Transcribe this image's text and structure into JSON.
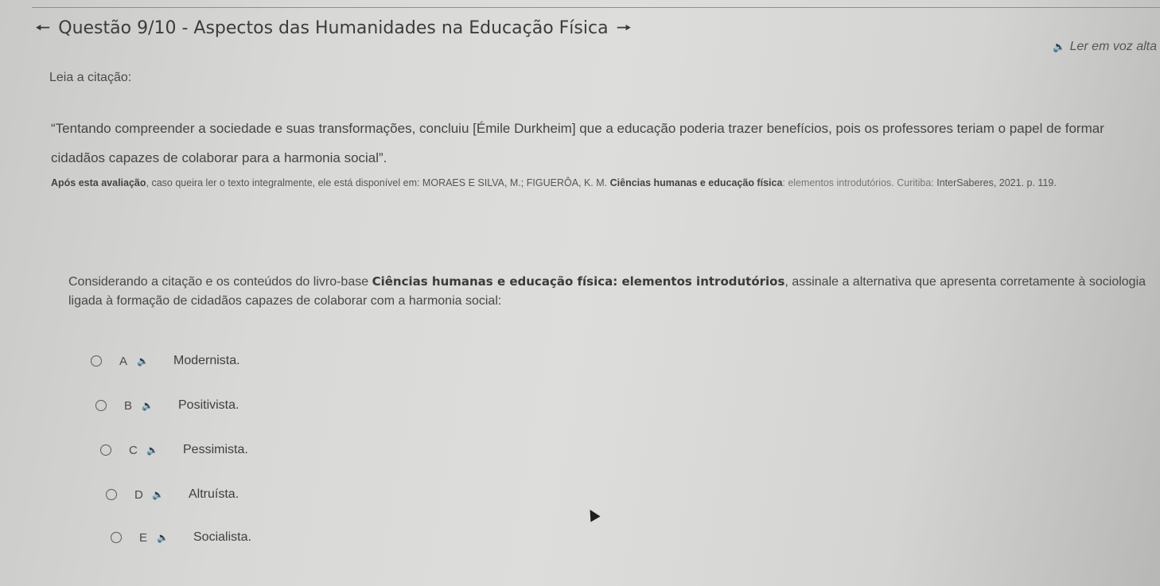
{
  "header": {
    "title": "Questão 9/10 - Aspectos das Humanidades na Educação Física",
    "prev_icon": "arrow-left-icon",
    "next_icon": "arrow-right-icon"
  },
  "read_aloud": {
    "label": "Ler em voz alta",
    "icon": "speaker-icon"
  },
  "instruction": "Leia a citação:",
  "quote": "“Tentando compreender a sociedade e suas transformações, concluiu [Émile Durkheim] que a educação poderia trazer benefícios, pois os professores teriam o papel de formar cidadãos capazes de colaborar para a harmonia social”.",
  "reference": {
    "lead": "Após esta avaliação",
    "middle": ", caso queira ler o texto integralmente, ele está disponível em: MORAES E SILVA, M.; FIGUERÔA, K. M. ",
    "book_title": "Ciências humanas e educação física",
    "tail_italic": ": elementos introdutórios. Curitiba:",
    "end": " InterSaberes, 2021. p. 119."
  },
  "question": {
    "before": "Considerando a citação e os conteúdos do livro-base ",
    "book": "Ciências humanas e educação física: elementos introdutórios",
    "after": ", assinale a alternativa que apresenta corretamente à sociologia ligada à formação de cidadãos capazes de colaborar com a harmonia social:"
  },
  "options": [
    {
      "letter": "A",
      "text": "Modernista."
    },
    {
      "letter": "B",
      "text": "Positivista."
    },
    {
      "letter": "C",
      "text": "Pessimista."
    },
    {
      "letter": "D",
      "text": "Altruísta."
    },
    {
      "letter": "E",
      "text": "Socialista."
    }
  ]
}
